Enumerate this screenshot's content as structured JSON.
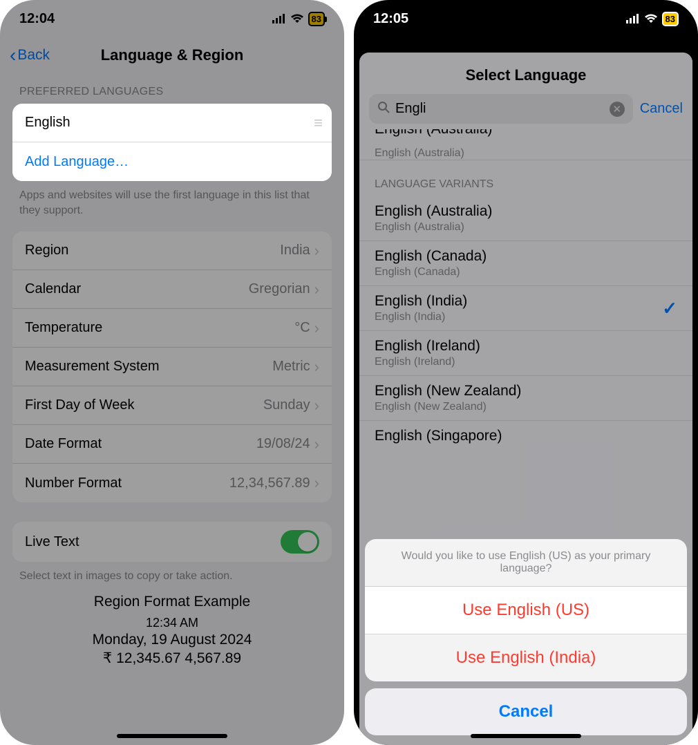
{
  "left": {
    "status": {
      "time": "12:04",
      "battery": "83"
    },
    "nav": {
      "back": "Back",
      "title": "Language & Region"
    },
    "preferred_header": "PREFERRED LANGUAGES",
    "english": "English",
    "add_language": "Add Language…",
    "preferred_footer": "Apps and websites will use the first language in this list that they support.",
    "rows": {
      "region": {
        "label": "Region",
        "value": "India"
      },
      "calendar": {
        "label": "Calendar",
        "value": "Gregorian"
      },
      "temperature": {
        "label": "Temperature",
        "value": "°C"
      },
      "measurement": {
        "label": "Measurement System",
        "value": "Metric"
      },
      "first_day": {
        "label": "First Day of Week",
        "value": "Sunday"
      },
      "date_format": {
        "label": "Date Format",
        "value": "19/08/24"
      },
      "number_format": {
        "label": "Number Format",
        "value": "12,34,567.89"
      }
    },
    "live_text": "Live Text",
    "live_text_footer": "Select text in images to copy or take action.",
    "example": {
      "title": "Region Format Example",
      "time": "12:34 AM",
      "date": "Monday, 19 August 2024",
      "numbers": "₹ 12,345.67   4,567.89"
    }
  },
  "right": {
    "status": {
      "time": "12:05",
      "battery": "83"
    },
    "sheet_title": "Select Language",
    "search": {
      "value": "Engli",
      "cancel": "Cancel"
    },
    "top_item": {
      "primary": "English (Australia)",
      "secondary": "English (Australia)"
    },
    "variants_header": "LANGUAGE VARIANTS",
    "variants": [
      {
        "primary": "English (Australia)",
        "secondary": "English (Australia)",
        "checked": false
      },
      {
        "primary": "English (Canada)",
        "secondary": "English (Canada)",
        "checked": false
      },
      {
        "primary": "English (India)",
        "secondary": "English (India)",
        "checked": true
      },
      {
        "primary": "English (Ireland)",
        "secondary": "English (Ireland)",
        "checked": false
      },
      {
        "primary": "English (New Zealand)",
        "secondary": "English (New Zealand)",
        "checked": false
      },
      {
        "primary": "English (Singapore)",
        "secondary": "",
        "checked": false
      }
    ],
    "action": {
      "message": "Would you like to use English (US) as your primary language?",
      "use_us": "Use English (US)",
      "use_india": "Use English (India)",
      "cancel": "Cancel"
    }
  }
}
